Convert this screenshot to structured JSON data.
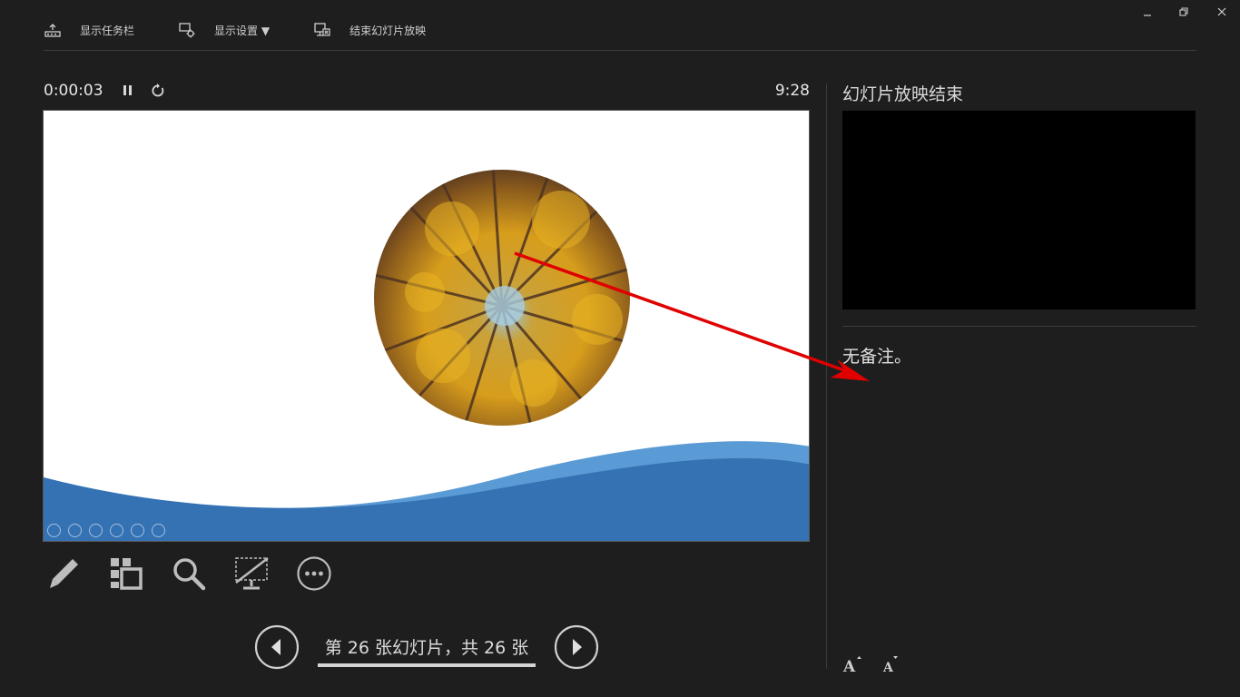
{
  "toolbar": {
    "show_taskbar": "显示任务栏",
    "display_settings": "显示设置 ▼",
    "end_slideshow": "结束幻灯片放映"
  },
  "timer": {
    "elapsed": "0:00:03",
    "clock": "9:28"
  },
  "navigation": {
    "slide_counter": "第 26 张幻灯片，共 26 张"
  },
  "next_slide": {
    "title": "幻灯片放映结束"
  },
  "notes": {
    "text": "无备注。"
  },
  "colors": {
    "background": "#1e1e1e",
    "wave_dark": "#3572b4",
    "wave_light": "#5b9bd5",
    "annotation_arrow": "#e00000"
  },
  "icons": [
    "taskbar-icon",
    "display-settings-icon",
    "end-show-icon",
    "pause-icon",
    "reset-icon",
    "pen-icon",
    "see-all-slides-icon",
    "zoom-icon",
    "black-screen-icon",
    "more-options-icon",
    "previous-icon",
    "next-icon",
    "increase-font-icon",
    "decrease-font-icon",
    "minimize-icon",
    "restore-icon",
    "close-icon"
  ]
}
